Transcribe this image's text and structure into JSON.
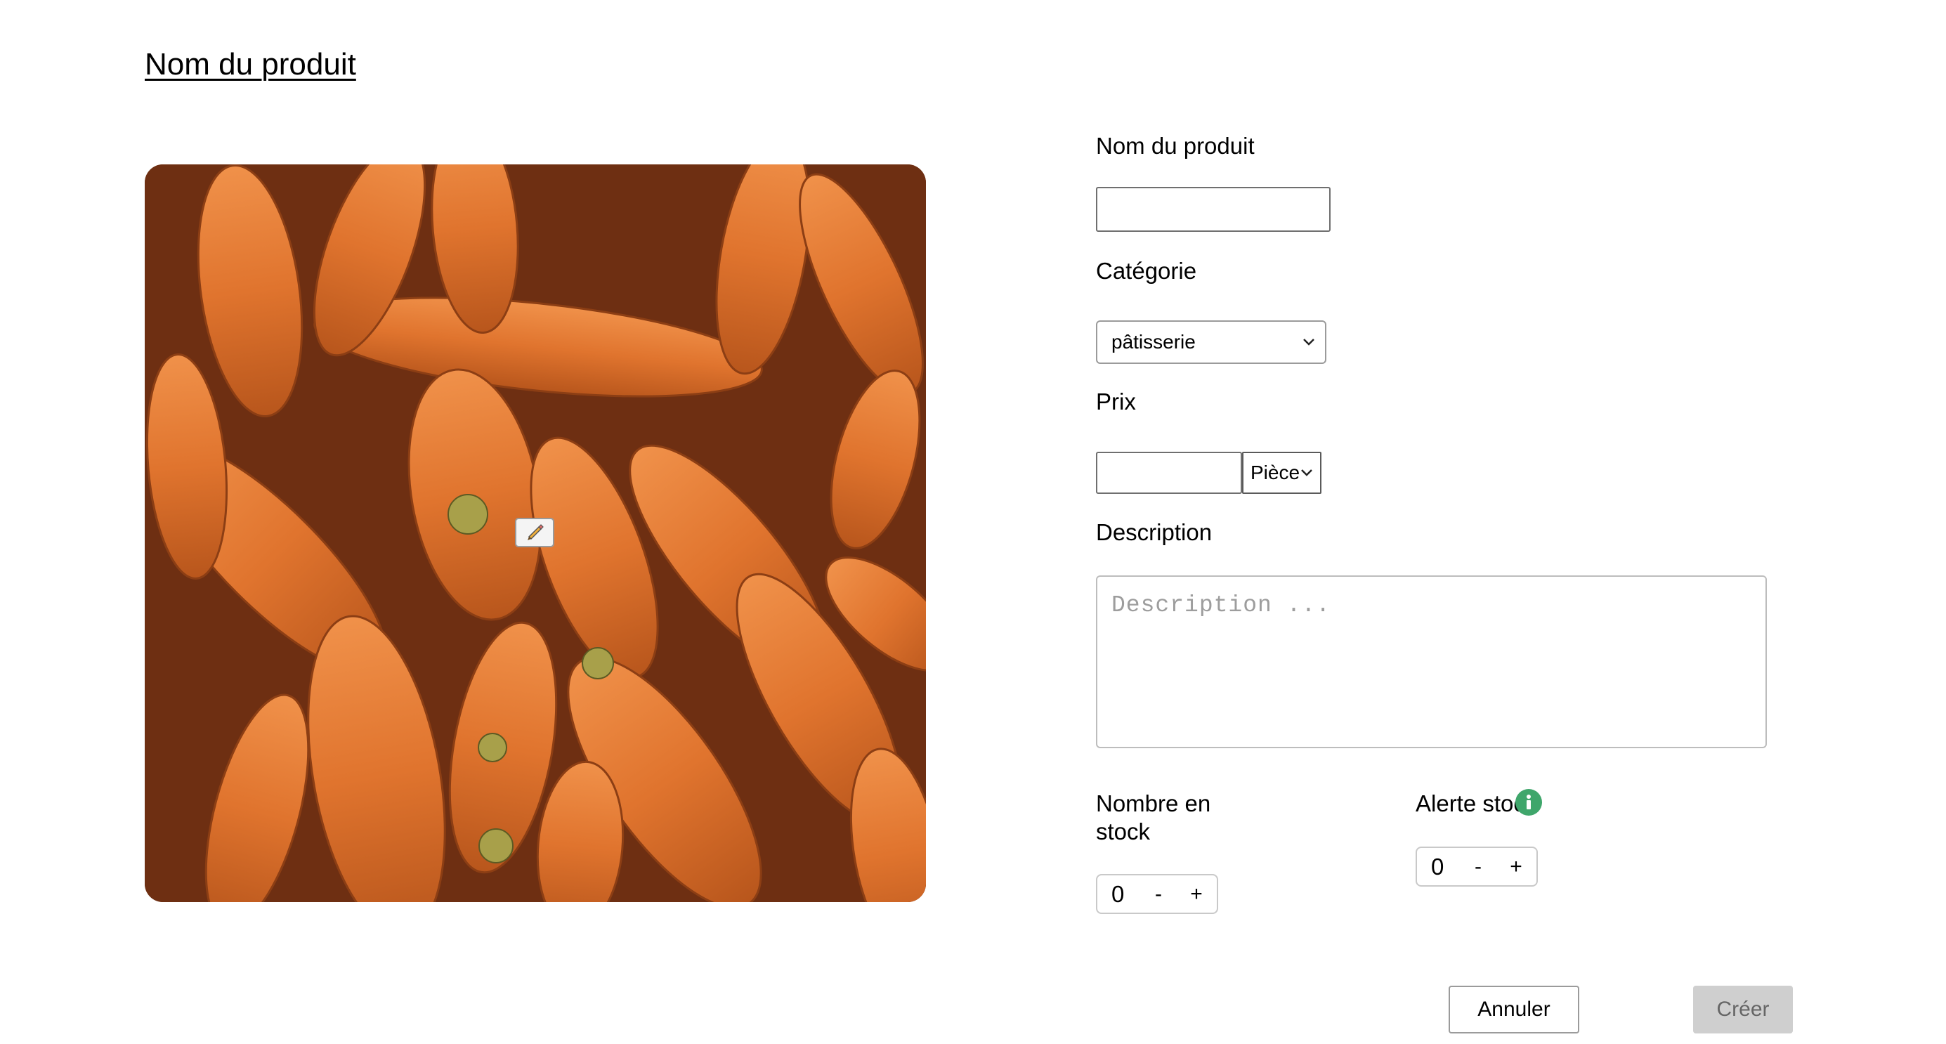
{
  "page": {
    "title": "Nom du produit"
  },
  "image": {
    "subject": "carrots",
    "edit_icon": "pencil-icon"
  },
  "form": {
    "name": {
      "label": "Nom du produit",
      "value": ""
    },
    "category": {
      "label": "Catégorie",
      "selected": "pâtisserie"
    },
    "price": {
      "label": "Prix",
      "value": "",
      "unit_selected": "Pièce"
    },
    "description": {
      "label": "Description",
      "placeholder": "Description ...",
      "value": ""
    },
    "stock": {
      "label_line1": "Nombre en",
      "label_line2": "stock",
      "value": "0",
      "minus": "-",
      "plus": "+"
    },
    "stock_alert": {
      "label": "Alerte stock",
      "value": "0",
      "minus": "-",
      "plus": "+",
      "info_icon": "info-icon"
    }
  },
  "actions": {
    "cancel_label": "Annuler",
    "create_label": "Créer"
  },
  "colors": {
    "info_green": "#3fa66b",
    "create_disabled_bg": "#cfcfcf"
  }
}
